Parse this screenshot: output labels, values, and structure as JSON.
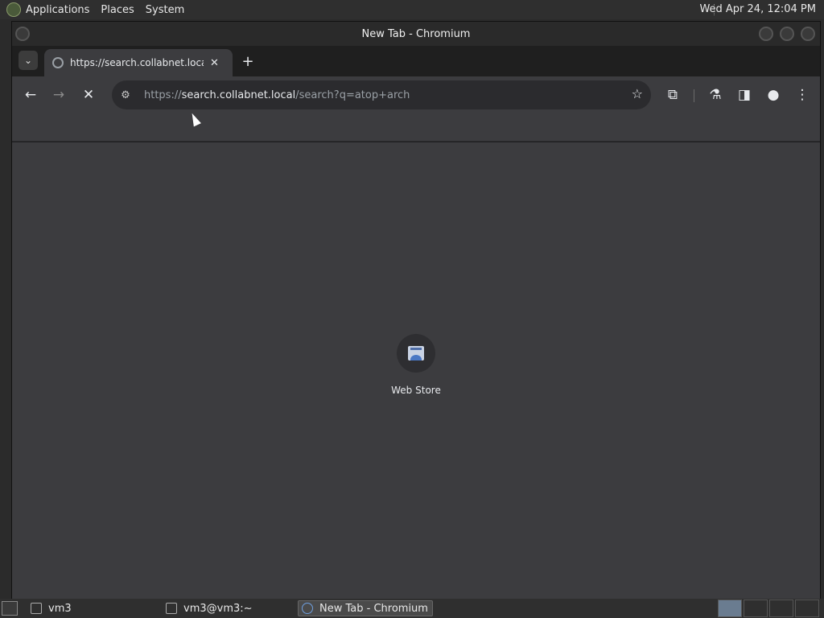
{
  "top_panel": {
    "menus": [
      "Applications",
      "Places",
      "System"
    ],
    "clock": "Wed Apr 24, 12:04 PM"
  },
  "window": {
    "title": "New Tab - Chromium"
  },
  "tabs": [
    {
      "title": "https://search.collabnet.local",
      "favicon": "globe-icon"
    }
  ],
  "toolbar": {
    "url_scheme": "https://",
    "url_host": "search.collabnet.local",
    "url_path": "/search?q=atop+arch"
  },
  "new_tab_page": {
    "shortcuts": [
      {
        "label": "Web Store",
        "icon": "web-store-icon"
      }
    ]
  },
  "taskbar": {
    "items": [
      {
        "label": "vm3",
        "icon": "home-folder-icon",
        "active": false
      },
      {
        "label": "vm3@vm3:~",
        "icon": "terminal-icon",
        "active": false
      },
      {
        "label": "New Tab - Chromium",
        "icon": "chromium-icon",
        "active": true
      }
    ]
  }
}
